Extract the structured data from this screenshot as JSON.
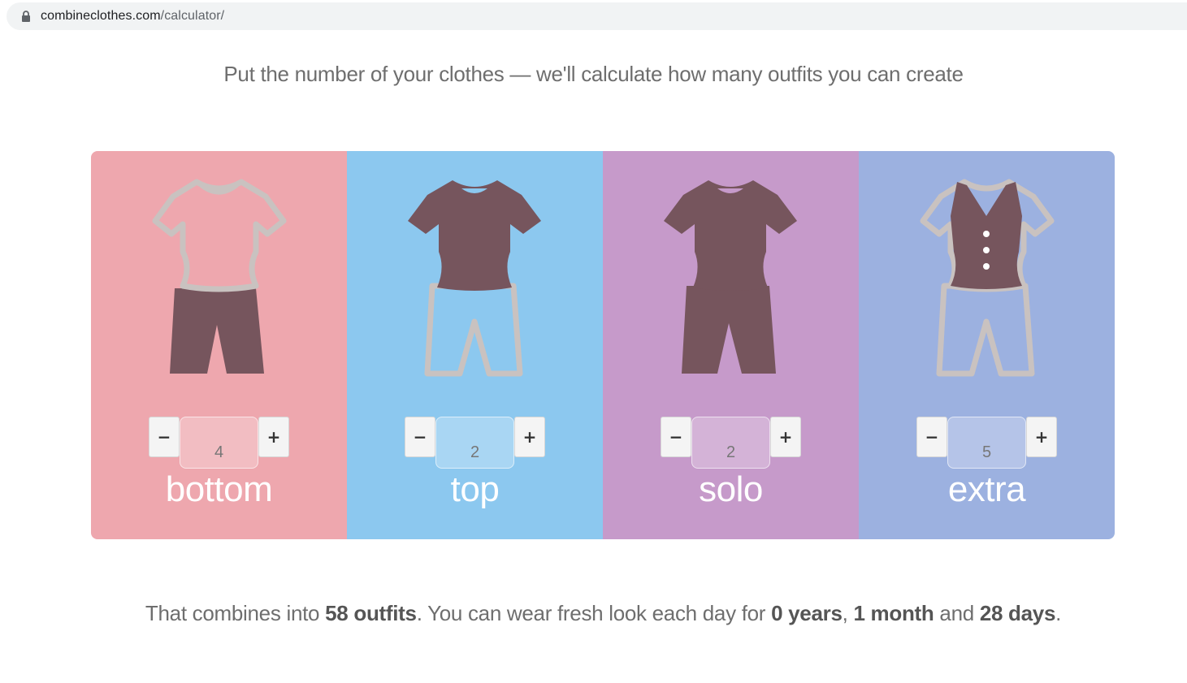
{
  "browser": {
    "url_domain": "combineclothes.com",
    "url_path": "/calculator/",
    "lock_icon": "lock-icon"
  },
  "headline": "Put the number of your clothes — we'll calculate how many outfits you can create",
  "colors": {
    "bottom": "#eea7ae",
    "top": "#8cc8ef",
    "solo": "#c69aca",
    "extra": "#9cb1e0",
    "garment_dark": "#76555d",
    "garment_outline": "#c9c2c0"
  },
  "columns": [
    {
      "label": "bottom",
      "value": "4",
      "minus": "−",
      "plus": "+",
      "icon": "bottom-outfit-icon"
    },
    {
      "label": "top",
      "value": "2",
      "minus": "−",
      "plus": "+",
      "icon": "top-outfit-icon"
    },
    {
      "label": "solo",
      "value": "2",
      "minus": "−",
      "plus": "+",
      "icon": "solo-outfit-icon"
    },
    {
      "label": "extra",
      "value": "5",
      "minus": "−",
      "plus": "+",
      "icon": "extra-outfit-icon"
    }
  ],
  "result": {
    "prefix": "That combines into ",
    "outfits": "58 outfits",
    "middle": ". You can wear fresh look each day for ",
    "years": "0 years",
    "sep": ", ",
    "months": "1 month",
    "and": " and ",
    "days": "28 days",
    "suffix": "."
  }
}
